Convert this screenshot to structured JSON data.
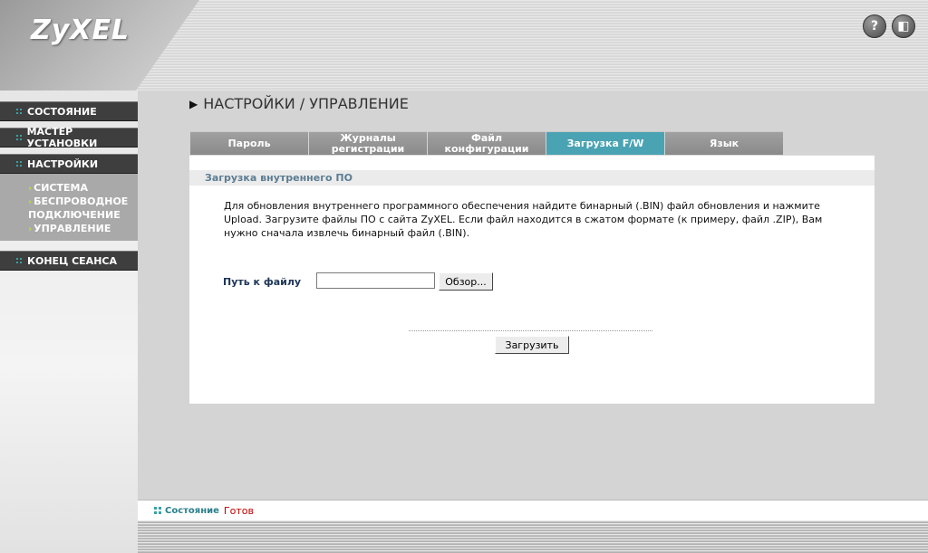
{
  "brand": {
    "logo_text": "ZyXEL"
  },
  "header": {
    "help_icon": "?",
    "logout_icon": "◧"
  },
  "sidebar": {
    "items": [
      {
        "label": "СОСТОЯНИЕ"
      },
      {
        "label": "МАСТЕР УСТАНОВКИ"
      },
      {
        "label": "НАСТРОЙКИ"
      },
      {
        "label": "КОНЕЦ СЕАНСА"
      }
    ],
    "submenu": [
      {
        "label": "СИСТЕМА"
      },
      {
        "label": "БЕСПРОВОДНОЕ"
      },
      {
        "label": "ПОДКЛЮЧЕНИЕ"
      },
      {
        "label": "УПРАВЛЕНИЕ"
      }
    ]
  },
  "page": {
    "title": "НАСТРОЙКИ / УПРАВЛЕНИЕ",
    "tabs": [
      {
        "line1": "Пароль",
        "line2": ""
      },
      {
        "line1": "Журналы",
        "line2": "регистрации"
      },
      {
        "line1": "Файл",
        "line2": "конфигурации"
      },
      {
        "line1": "Загрузка F/W",
        "line2": ""
      },
      {
        "line1": "Язык",
        "line2": ""
      }
    ],
    "active_tab": "Загрузка F/W",
    "section_title": "Загрузка внутреннего ПО",
    "description": "Для обновления внутреннего программного обеспечения найдите бинарный (.BIN) файл обновления и нажмите Upload. Загрузите файлы ПО с сайта ZyXEL. Если файл находится в сжатом формате (к примеру, файл .ZIP), Вам нужно сначала извлечь бинарный файл (.BIN).",
    "file_label": "Путь к файлу",
    "file_value": "",
    "browse_label": "Обзор...",
    "upload_label": "Загрузить"
  },
  "status": {
    "label": "Состояние",
    "value": "Готов"
  },
  "colors": {
    "accent": "#4aa3b3",
    "nav_bg": "#3e3e3e",
    "status_ready": "#c00000"
  }
}
